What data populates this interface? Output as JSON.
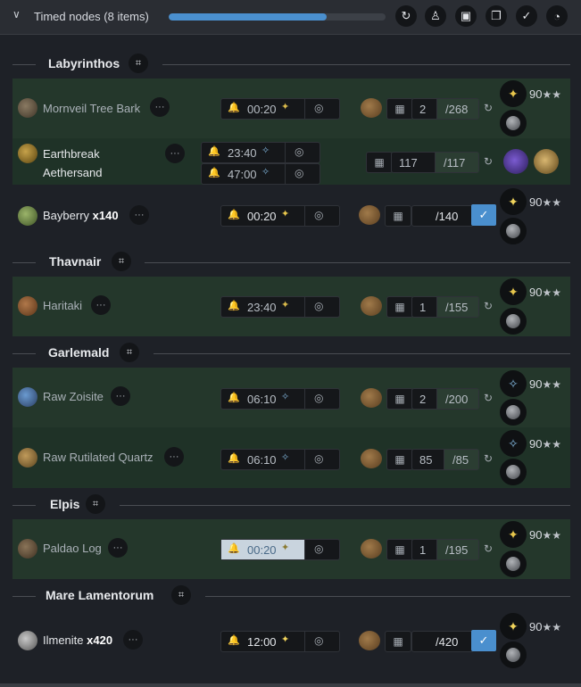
{
  "header": {
    "title": "Timed nodes (8 items)",
    "progress_percent": 73,
    "buttons": [
      "refresh-icon",
      "user-icon",
      "money-icon",
      "copy-icon",
      "check-icon",
      "swirl-icon"
    ]
  },
  "colors": {
    "accent": "#4a8fce",
    "row_green": "#24372b",
    "background": "#1e2127"
  },
  "sections": [
    {
      "name": "Labyrinthos",
      "items": [
        {
          "name": "Mornveil Tree Bark",
          "times": [
            "00:20"
          ],
          "have": "2",
          "need": "/268",
          "level": "90",
          "stars": "★★"
        },
        {
          "name_line1": "Earthbreak",
          "name_line2": "Aethersand",
          "times": [
            "23:40",
            "47:00"
          ],
          "have": "117",
          "need": "/117"
        },
        {
          "name": "Bayberry",
          "count": "x140",
          "times": [
            "00:20"
          ],
          "have": "",
          "need": "/140",
          "level": "90",
          "stars": "★★"
        }
      ]
    },
    {
      "name": "Thavnair",
      "items": [
        {
          "name": "Haritaki",
          "times": [
            "23:40"
          ],
          "have": "1",
          "need": "/155",
          "level": "90",
          "stars": "★★"
        }
      ]
    },
    {
      "name": "Garlemald",
      "items": [
        {
          "name": "Raw Zoisite",
          "times": [
            "06:10"
          ],
          "have": "2",
          "need": "/200",
          "level": "90",
          "stars": "★★"
        },
        {
          "name": "Raw Rutilated Quartz",
          "times": [
            "06:10"
          ],
          "have": "85",
          "need": "/85",
          "level": "90",
          "stars": "★★"
        }
      ]
    },
    {
      "name": "Elpis",
      "items": [
        {
          "name": "Paldao Log",
          "times": [
            "00:20"
          ],
          "have": "1",
          "need": "/195",
          "level": "90",
          "stars": "★★"
        }
      ]
    },
    {
      "name": "Mare Lamentorum",
      "items": [
        {
          "name": "Ilmenite",
          "count": "x420",
          "times": [
            "12:00"
          ],
          "have": "",
          "need": "/420",
          "level": "90",
          "stars": "★★"
        }
      ]
    }
  ],
  "glyphs": {
    "chevron": "∨",
    "more": "···",
    "bell": "🔔",
    "pin": "◎",
    "calc": "▦",
    "reset": "↻",
    "check": "✓",
    "nav": "⌗"
  }
}
